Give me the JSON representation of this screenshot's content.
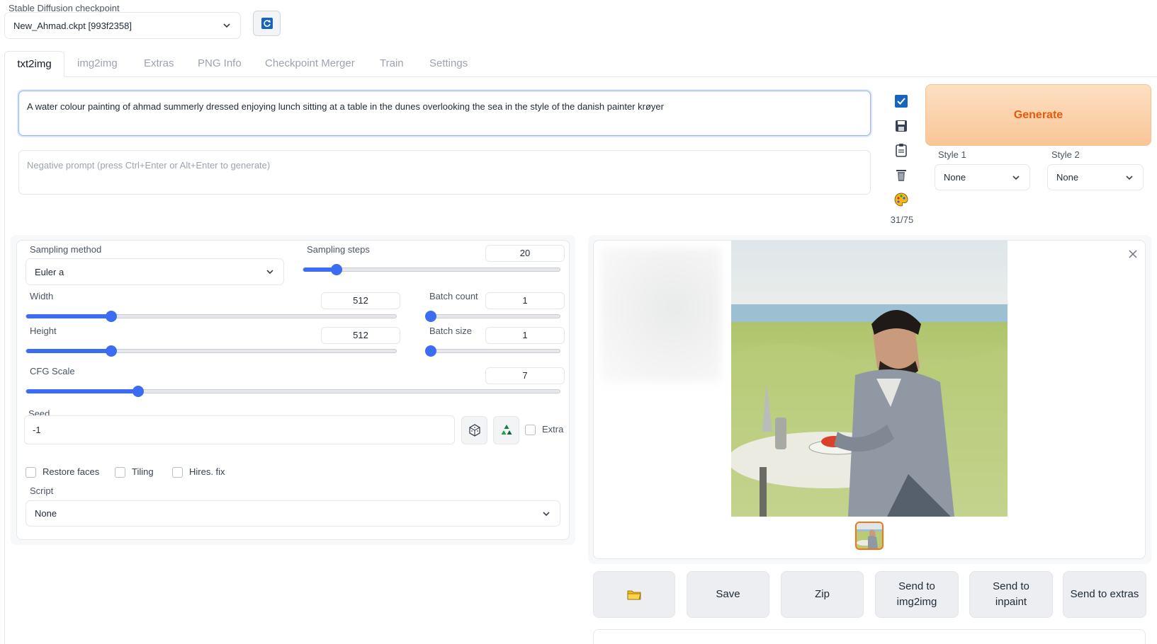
{
  "checkpoint": {
    "label": "Stable Diffusion checkpoint",
    "value": "New_Ahmad.ckpt [993f2358]"
  },
  "tabs": [
    {
      "label": "txt2img",
      "active": true
    },
    {
      "label": "img2img"
    },
    {
      "label": "Extras"
    },
    {
      "label": "PNG Info"
    },
    {
      "label": "Checkpoint Merger"
    },
    {
      "label": "Train"
    },
    {
      "label": "Settings"
    }
  ],
  "prompt": {
    "value": "A water colour painting of ahmad summerly dressed enjoying lunch sitting at a table in the dunes overlooking the sea in the style of the danish painter krøyer"
  },
  "negative_prompt": {
    "placeholder": "Negative prompt (press Ctrl+Enter or Alt+Enter to generate)"
  },
  "token_count": "31/75",
  "generate_label": "Generate",
  "styles": [
    {
      "label": "Style 1",
      "value": "None"
    },
    {
      "label": "Style 2",
      "value": "None"
    }
  ],
  "sampling": {
    "method_label": "Sampling method",
    "method_value": "Euler a",
    "steps_label": "Sampling steps",
    "steps_value": "20",
    "steps_fraction": 0.13
  },
  "width": {
    "label": "Width",
    "value": "512",
    "fraction": 0.23
  },
  "height": {
    "label": "Height",
    "value": "512",
    "fraction": 0.23
  },
  "batch_count": {
    "label": "Batch count",
    "value": "1",
    "fraction": 0.0
  },
  "batch_size": {
    "label": "Batch size",
    "value": "1",
    "fraction": 0.0
  },
  "cfg": {
    "label": "CFG Scale",
    "value": "7",
    "fraction": 0.21
  },
  "seed": {
    "label": "Seed",
    "value": "-1",
    "extra_label": "Extra"
  },
  "options": {
    "restore_faces": "Restore faces",
    "tiling": "Tiling",
    "hires_fix": "Hires. fix"
  },
  "script": {
    "label": "Script",
    "value": "None"
  },
  "actions": {
    "save": "Save",
    "zip": "Zip",
    "send_img2img": "Send to img2img",
    "send_inpaint": "Send to inpaint",
    "send_extras": "Send to extras"
  },
  "colors": {
    "accent": "#3b6cf1",
    "generate_bg": "#fbd0aa",
    "generate_text": "#ea580c"
  },
  "icons": [
    "refresh-icon",
    "checkbox-icon",
    "save-disk-icon",
    "clipboard-icon",
    "trash-icon",
    "palette-icon",
    "dice-icon",
    "recycle-icon",
    "folder-icon",
    "close-icon",
    "chevron-down-icon"
  ]
}
